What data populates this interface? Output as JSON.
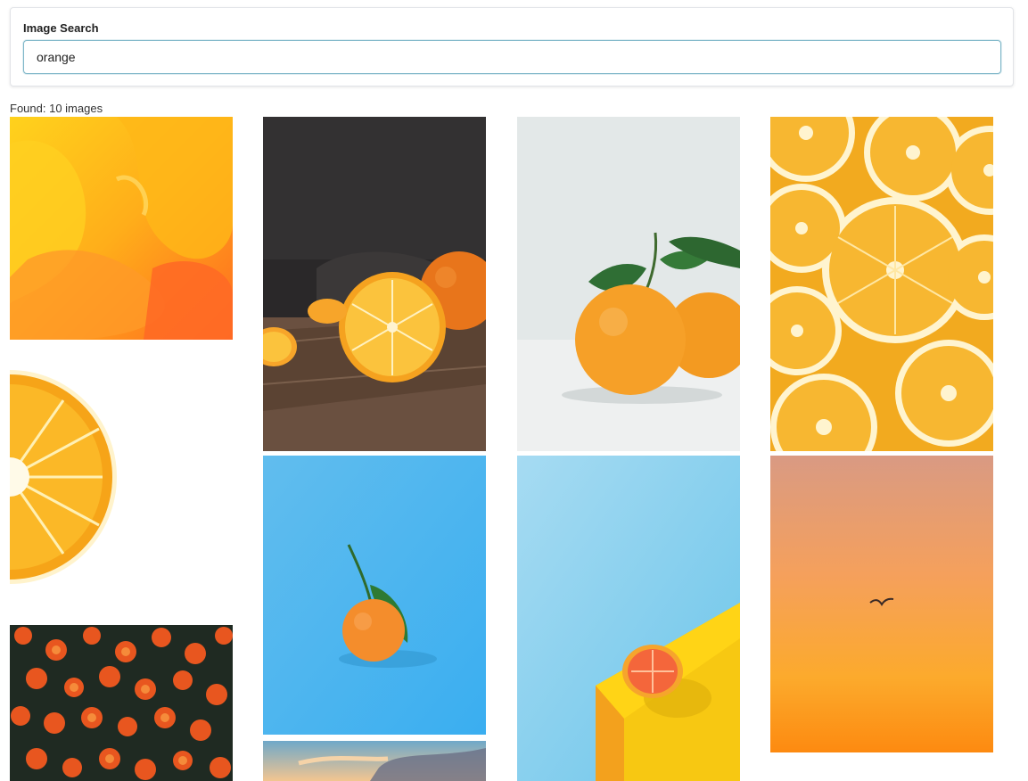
{
  "search": {
    "label": "Image Search",
    "value": "orange",
    "placeholder": ""
  },
  "results": {
    "summary": "Found: 10 images"
  },
  "images": [
    {
      "subject": "abstract-orange-yellow-paint"
    },
    {
      "subject": "orange-half-on-wooden-board"
    },
    {
      "subject": "two-oranges-with-leaves"
    },
    {
      "subject": "orange-slices-pattern"
    },
    {
      "subject": "orange-half-on-white"
    },
    {
      "subject": "tangerine-on-blue"
    },
    {
      "subject": "grapefruit-half-on-yellow-block"
    },
    {
      "subject": "orange-sky-with-bird"
    },
    {
      "subject": "orange-flowers"
    },
    {
      "subject": "sunset-clouds"
    }
  ],
  "colors": {
    "input_focus_border": "#7fb7c9",
    "blue_background": "#4fb4ea",
    "orange": "#f7a21b"
  }
}
